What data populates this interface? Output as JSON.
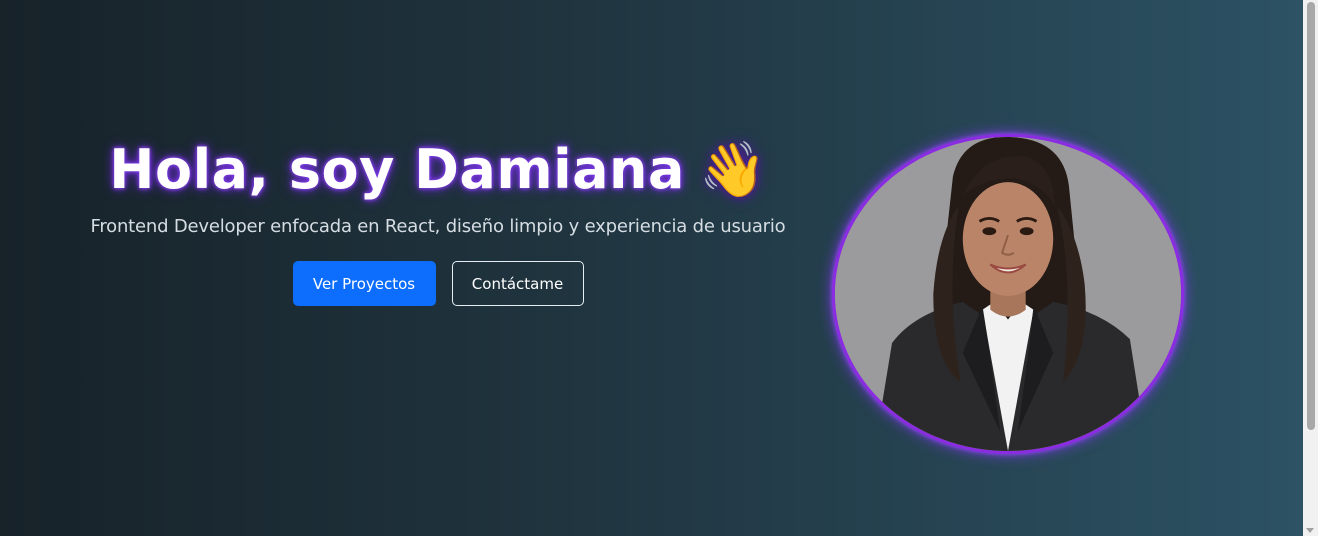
{
  "hero": {
    "title": "Hola, soy Damiana",
    "title_emoji": "👋",
    "subtitle": "Frontend Developer enfocada en React, diseño limpio y experiencia de usuario",
    "primary_button": "Ver Proyectos",
    "secondary_button": "Contáctame"
  },
  "profile": {
    "image_alt": "Damiana"
  },
  "colors": {
    "background_start": "#172229",
    "background_end": "#2c5264",
    "primary_button": "#0d6efd",
    "avatar_border": "#8b2be2",
    "title_glow": "#7c3aed"
  },
  "icons": {
    "wave": "waving-hand-icon"
  }
}
